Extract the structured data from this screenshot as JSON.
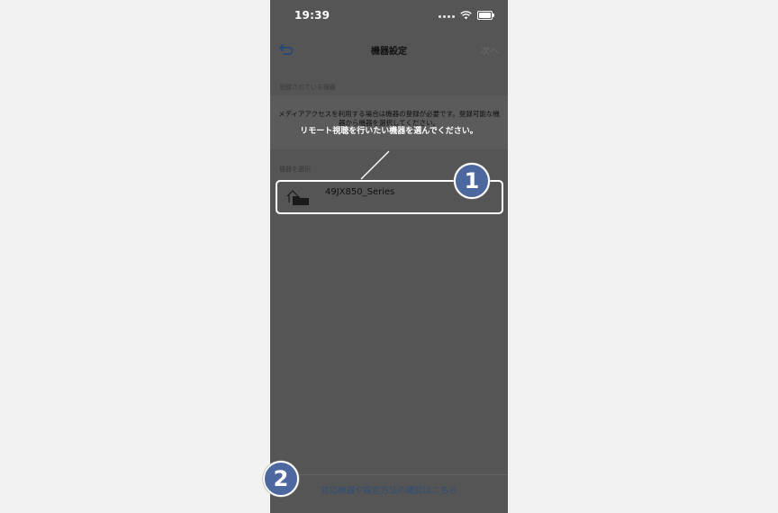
{
  "status_bar": {
    "time": "19:39"
  },
  "nav": {
    "title": "機器設定",
    "next_label": "次へ"
  },
  "registered_section": {
    "header": "登録されている機器",
    "message": "メディアアクセスを利用する場合は機器の登録が必要です。登録可能な機器から機器を選択してください。"
  },
  "callout": {
    "text": "リモート視聴を行いたい機器を選んでください。"
  },
  "select_section": {
    "header": "機器を選択",
    "devices": [
      {
        "name": "49JX850_Series"
      }
    ]
  },
  "footer": {
    "link_label": "対応機器や設定方法の確認はこちら"
  },
  "badges": [
    {
      "number": "1"
    },
    {
      "number": "2"
    }
  ],
  "colors": {
    "overlay": "#555555",
    "badge": "#4d679f",
    "link": "#2e4d77",
    "background": "#f2f2f2"
  }
}
